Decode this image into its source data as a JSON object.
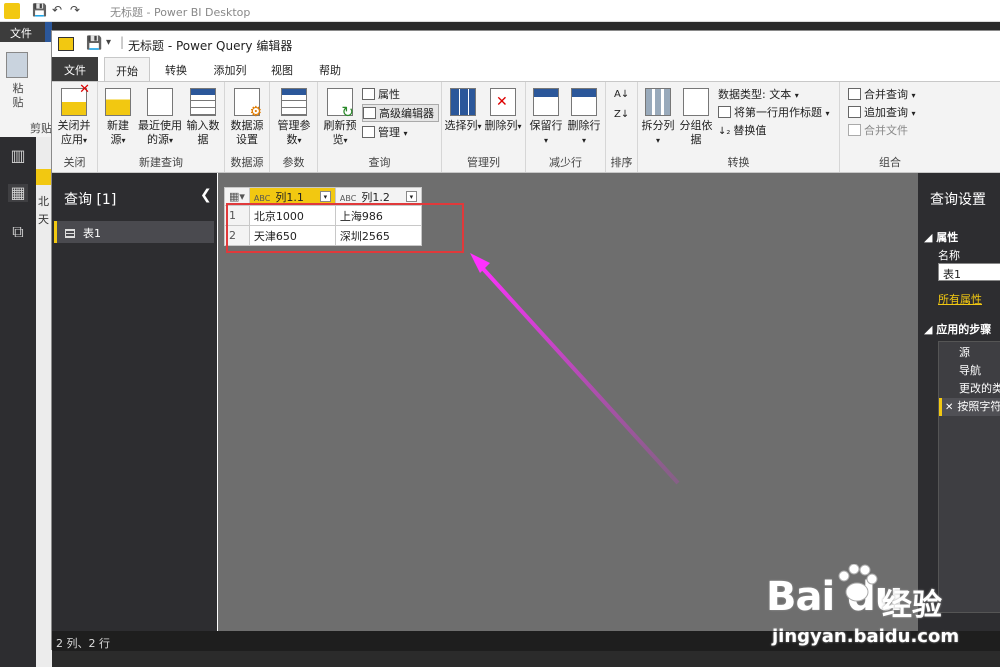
{
  "background_window": {
    "title": "无标题 - Power BI Desktop",
    "file_tab": "文件",
    "paste_label": "粘\n贴",
    "clipboard_label": "剪贴",
    "canvas_text_1": "北",
    "canvas_text_2": "天"
  },
  "editor": {
    "title": "无标题 - Power Query 编辑器",
    "tabs": [
      "文件",
      "开始",
      "转换",
      "添加列",
      "视图",
      "帮助"
    ],
    "ribbon": {
      "groups": {
        "close": {
          "label": "关闭",
          "btn": "关闭并应用"
        },
        "new_query": {
          "label": "新建查询",
          "btn_new": "新建源",
          "btn_recent": "最近使用的源",
          "btn_enter": "输入数据"
        },
        "data_source": {
          "label": "数据源",
          "btn": "数据源设置"
        },
        "params": {
          "label": "参数",
          "btn": "管理参数"
        },
        "query": {
          "label": "查询",
          "btn_refresh": "刷新预览",
          "btn_props": "属性",
          "btn_adv": "高级编辑器",
          "btn_manage": "管理"
        },
        "manage_cols": {
          "label": "管理列",
          "btn_select": "选择列",
          "btn_remove": "删除列"
        },
        "reduce_rows": {
          "label": "减少行",
          "btn_keep": "保留行",
          "btn_remove": "删除行"
        },
        "sort": {
          "label": "排序"
        },
        "transform": {
          "label": "转换",
          "btn_split": "拆分列",
          "btn_group": "分组依据",
          "data_type": "数据类型: 文本",
          "first_row": "将第一行用作标题",
          "replace": "替换值"
        },
        "combine": {
          "label": "组合",
          "merge": "合并查询",
          "append": "追加查询",
          "combine_files": "合并文件"
        }
      }
    },
    "queries_pane": {
      "header": "查询 [1]",
      "items": [
        "表1"
      ]
    },
    "table": {
      "columns": [
        "列1.1",
        "列1.2"
      ],
      "column_type": "ABC",
      "rows": [
        {
          "num": "1",
          "c1": "北京1000",
          "c2": "上海986"
        },
        {
          "num": "2",
          "c1": "天津650",
          "c2": "深圳2565"
        }
      ]
    },
    "settings_pane": {
      "title": "查询设置",
      "properties_header": "属性",
      "name_label": "名称",
      "name_value": "表1",
      "all_properties": "所有属性",
      "steps_header": "应用的步骤",
      "steps": [
        "源",
        "导航",
        "更改的类",
        "按照字符"
      ]
    },
    "status": "2 列、2 行"
  },
  "watermark": {
    "logo": "Bai  du",
    "suffix": "经验",
    "url": "jingyan.baidu.com"
  },
  "colors": {
    "accent_yellow": "#f2c811",
    "highlight_red": "#e0393b",
    "arrow_magenta": "#e040e0",
    "dark_pane": "#2d2d30"
  }
}
